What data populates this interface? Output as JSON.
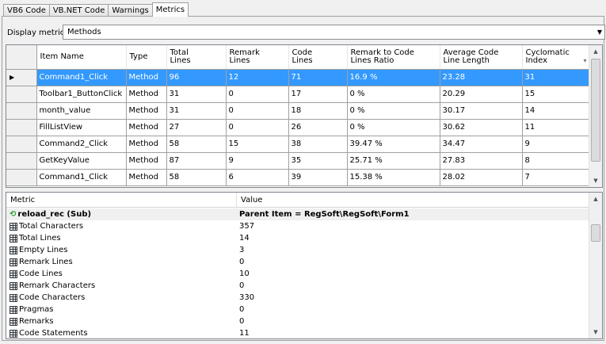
{
  "tabs": [
    "VB6 Code",
    "VB.NET Code",
    "Warnings",
    "Metrics"
  ],
  "active_tab": 3,
  "display": {
    "label": "Display metrics for:",
    "value": "Methods"
  },
  "grid": {
    "columns": [
      "Item Name",
      "Type",
      "Total\nLines",
      "Remark\nLines",
      "Code\nLines",
      "Remark to Code\nLines Ratio",
      "Average Code\nLine Length",
      "Cyclomatic\nIndex"
    ],
    "selected_row": 0,
    "rows": [
      [
        "Command1_Click",
        "Method",
        "96",
        "12",
        "71",
        "16.9 %",
        "23.28",
        "31"
      ],
      [
        "Toolbar1_ButtonClick",
        "Method",
        "31",
        "0",
        "17",
        "0 %",
        "20.29",
        "15"
      ],
      [
        "month_value",
        "Method",
        "31",
        "0",
        "18",
        "0 %",
        "30.17",
        "14"
      ],
      [
        "FillListView",
        "Method",
        "27",
        "0",
        "26",
        "0 %",
        "30.62",
        "11"
      ],
      [
        "Command2_Click",
        "Method",
        "58",
        "15",
        "38",
        "39.47 %",
        "34.47",
        "9"
      ],
      [
        "GetKeyValue",
        "Method",
        "87",
        "9",
        "35",
        "25.71 %",
        "27.83",
        "8"
      ],
      [
        "Command1_Click",
        "Method",
        "58",
        "6",
        "39",
        "15.38 %",
        "28.02",
        "7"
      ]
    ]
  },
  "metrics": {
    "col_metric": "Metric",
    "col_value": "Value",
    "header_row": {
      "metric": "reload_rec (Sub)",
      "value": "Parent Item = RegSoft\\RegSoft\\Form1"
    },
    "rows": [
      {
        "metric": "Total Characters",
        "value": "357"
      },
      {
        "metric": "Total Lines",
        "value": "14"
      },
      {
        "metric": "Empty Lines",
        "value": "3"
      },
      {
        "metric": "Remark Lines",
        "value": "0"
      },
      {
        "metric": "Code Lines",
        "value": "10"
      },
      {
        "metric": "Remark Characters",
        "value": "0"
      },
      {
        "metric": "Code Characters",
        "value": "330"
      },
      {
        "metric": "Pragmas",
        "value": "0"
      },
      {
        "metric": "Remarks",
        "value": "0"
      },
      {
        "metric": "Code Statements",
        "value": "11"
      }
    ]
  },
  "colors": {
    "selection": "#3399ff",
    "accent_icon": "#2e9d2e"
  },
  "icons": {
    "metric_row": "table-grid-icon",
    "method_row": "sub-method-icon",
    "row_pointer": "row-selector-arrow-icon"
  }
}
